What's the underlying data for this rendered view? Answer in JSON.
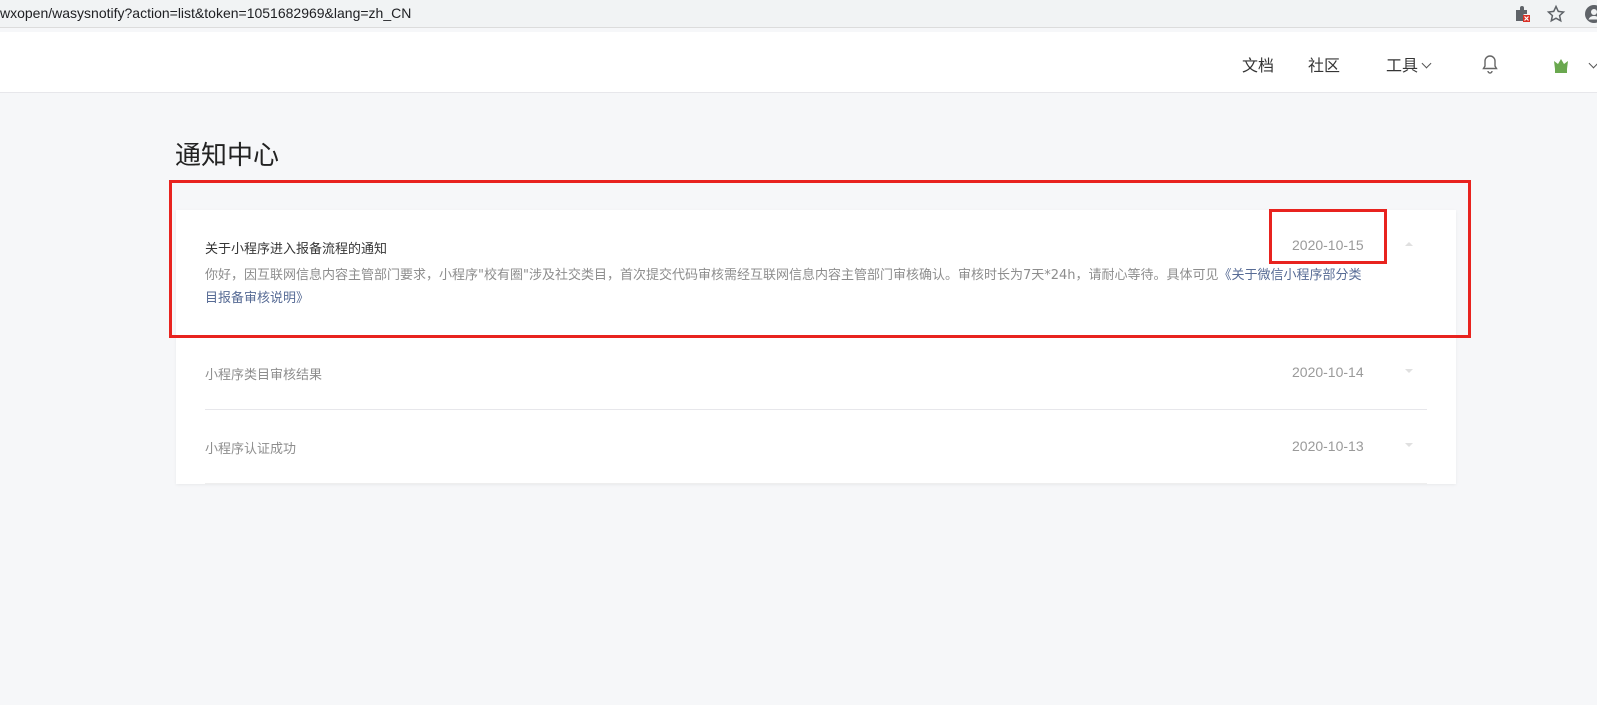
{
  "browser": {
    "url": "wxopen/wasysnotify?action=list&token=1051682969&lang=zh_CN",
    "icons": [
      "extension-icon",
      "star-icon",
      "profile-icon"
    ]
  },
  "nav": {
    "docs": "文档",
    "community": "社区",
    "tools": "工具",
    "icons": [
      "bell-icon",
      "avatar"
    ]
  },
  "page": {
    "title": "通知中心"
  },
  "notifications": [
    {
      "title": "关于小程序进入报备流程的通知",
      "date": "2020-10-15",
      "expanded": true,
      "body_text": "你好，因互联网信息内容主管部门要求，小程序\"校有圈\"涉及社交类目，首次提交代码审核需经互联网信息内容主管部门审核确认。审核时长为7天*24h，请耐心等待。具体可见",
      "body_link": "《关于微信小程序部分类目报备审核说明》"
    },
    {
      "title": "小程序类目审核结果",
      "date": "2020-10-14",
      "expanded": false
    },
    {
      "title": "小程序认证成功",
      "date": "2020-10-13",
      "expanded": false
    }
  ],
  "colors": {
    "highlight": "#e8231f",
    "link": "#576b95",
    "background": "#f6f7f9"
  }
}
